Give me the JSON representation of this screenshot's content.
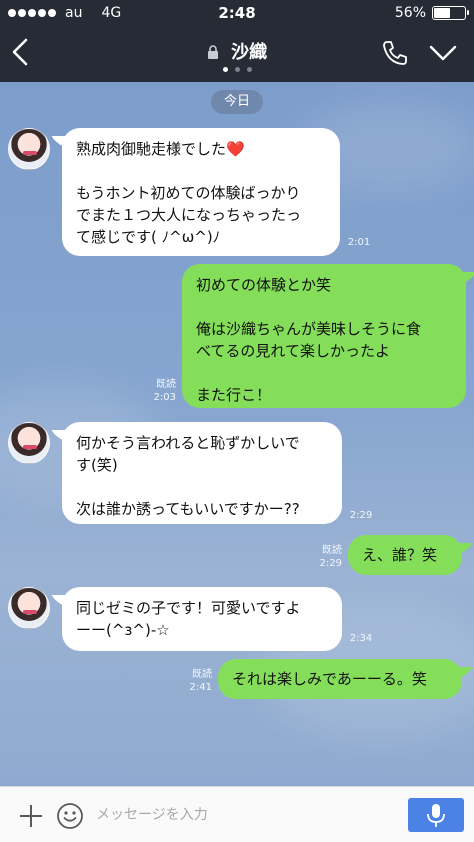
{
  "status_bar": {
    "carrier": "au",
    "network": "4G",
    "time": "2:48",
    "battery_percent": "56%",
    "battery_level": 0.56
  },
  "header": {
    "title": "沙織",
    "icons": {
      "back": "chevron-left-icon",
      "lock": "lock-icon",
      "call": "phone-icon",
      "menu": "chevron-down-icon"
    },
    "page_dots": 3,
    "active_page": 1
  },
  "chat": {
    "date_label": "今日",
    "messages": [
      {
        "side": "in",
        "text": "熟成肉御馳走様でした❤️\n\nもうホント初めての体験ばっかり\nでまた１つ大人になっちゃったっ\nて感じです( ﾉ^ω^)ﾉ",
        "time": "2:01"
      },
      {
        "side": "out",
        "text": "初めての体験とか笑\n\n俺は沙織ちゃんが美味しそうに食\nべてるの見れて楽しかったよ\n\nまた行こ！",
        "read": "既読",
        "time": "2:03"
      },
      {
        "side": "in",
        "text": "何かそう言われると恥ずかしいで\nす(笑)\n\n次は誰か誘ってもいいですかー??",
        "time": "2:29"
      },
      {
        "side": "out",
        "text": "え、誰？笑",
        "read": "既読",
        "time": "2:29"
      },
      {
        "side": "in",
        "text": "同じゼミの子です！可愛いですよ\nーー(^з^)-☆",
        "time": "2:34"
      },
      {
        "side": "out",
        "text": "それは楽しみであーーる。笑",
        "read": "既読",
        "time": "2:41"
      }
    ]
  },
  "input_bar": {
    "placeholder": "メッセージを入力",
    "icons": {
      "plus": "plus-icon",
      "sticker": "smile-icon",
      "mic": "microphone-icon"
    }
  },
  "colors": {
    "header_bg": "#262b36",
    "outgoing_bubble": "#84de5a",
    "incoming_bubble": "#ffffff",
    "mic_button": "#4c82e6"
  }
}
